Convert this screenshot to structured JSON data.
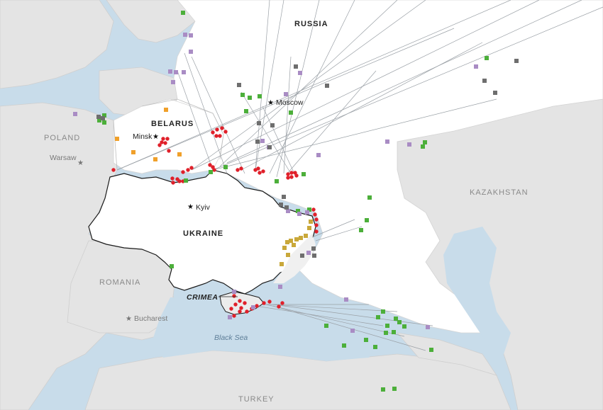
{
  "labels": {
    "russia": "RUSSIA",
    "belarus": "BELARUS",
    "ukraine": "UKRAINE",
    "poland": "POLAND",
    "romania": "ROMANIA",
    "kazakhstan": "KAZAKHSTAN",
    "turkey": "TURKEY",
    "crimea": "CRIMEA",
    "black_sea": "Black Sea",
    "moscow": "Moscow",
    "minsk": "Minsk",
    "kyiv": "Kyiv",
    "warsaw": "Warsaw",
    "bucharest": "Bucharest"
  },
  "colors": {
    "sea": "#c8dcea",
    "land_other": "#e4e4e4",
    "land_focus": "#ffffff",
    "border": "#1a1a1a",
    "route": "#9aa0a6",
    "red": "#e0202a",
    "green": "#4caf3a",
    "purple": "#a98cc4",
    "grey": "#6e6e6e",
    "orange": "#f0a02a",
    "gold": "#c9a83a"
  },
  "markers": {
    "red_circle": "red-circle-marker",
    "green_square": "green-square-marker",
    "purple_square": "purple-square-marker",
    "grey_square": "grey-square-marker",
    "orange_square": "orange-square-marker",
    "gold_square": "gold-square-marker"
  }
}
